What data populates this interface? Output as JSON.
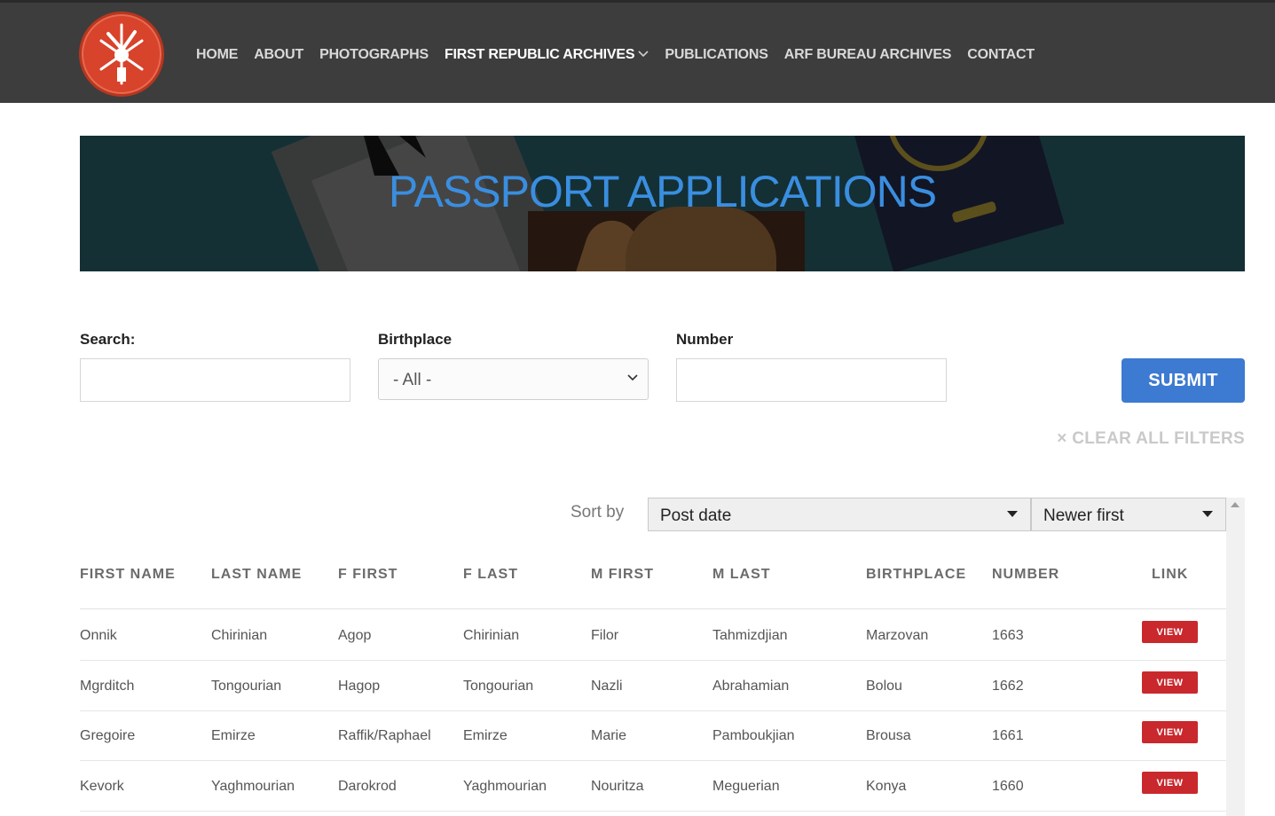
{
  "nav": {
    "items": [
      {
        "label": "HOME"
      },
      {
        "label": "ABOUT"
      },
      {
        "label": "PHOTOGRAPHS"
      },
      {
        "label": "FIRST REPUBLIC ARCHIVES"
      },
      {
        "label": "PUBLICATIONS"
      },
      {
        "label": "ARF BUREAU ARCHIVES"
      },
      {
        "label": "CONTACT"
      }
    ]
  },
  "banner": {
    "title": "PASSPORT APPLICATIONS"
  },
  "filters": {
    "search_label": "Search:",
    "search_value": "",
    "birthplace_label": "Birthplace",
    "birthplace_value": "- All -",
    "number_label": "Number",
    "number_value": "",
    "submit_label": "SUBMIT",
    "clear_label": "× CLEAR ALL FILTERS"
  },
  "sort": {
    "label": "Sort by",
    "field": "Post date",
    "order": "Newer first"
  },
  "table": {
    "headers": [
      "FIRST NAME",
      "LAST NAME",
      "F FIRST",
      "F LAST",
      "M FIRST",
      "M LAST",
      "BIRTHPLACE",
      "NUMBER",
      "LINK"
    ],
    "rows": [
      [
        "Onnik",
        "Chirinian",
        "Agop",
        "Chirinian",
        "Filor",
        "Tahmizdjian",
        "Marzovan",
        "1663",
        "VIEW"
      ],
      [
        "Mgrditch",
        "Tongourian",
        "Hagop",
        "Tongourian",
        "Nazli",
        "Abrahamian",
        "Bolou",
        "1662",
        "VIEW"
      ],
      [
        "Gregoire",
        "Emirze",
        "Raffik/Raphael",
        "Emirze",
        "Marie",
        "Pamboukjian",
        "Brousa",
        "1661",
        "VIEW"
      ],
      [
        "Kevork",
        "Yaghmourian",
        "Darokrod",
        "Yaghmourian",
        "Nouritza",
        "Meguerian",
        "Konya",
        "1660",
        "VIEW"
      ]
    ]
  },
  "colors": {
    "header_bg": "#3d3d3d",
    "accent_blue": "#3d7ad1",
    "title_blue": "#3a8ee0",
    "view_red": "#c9282d",
    "logo_red": "#d8432b"
  }
}
